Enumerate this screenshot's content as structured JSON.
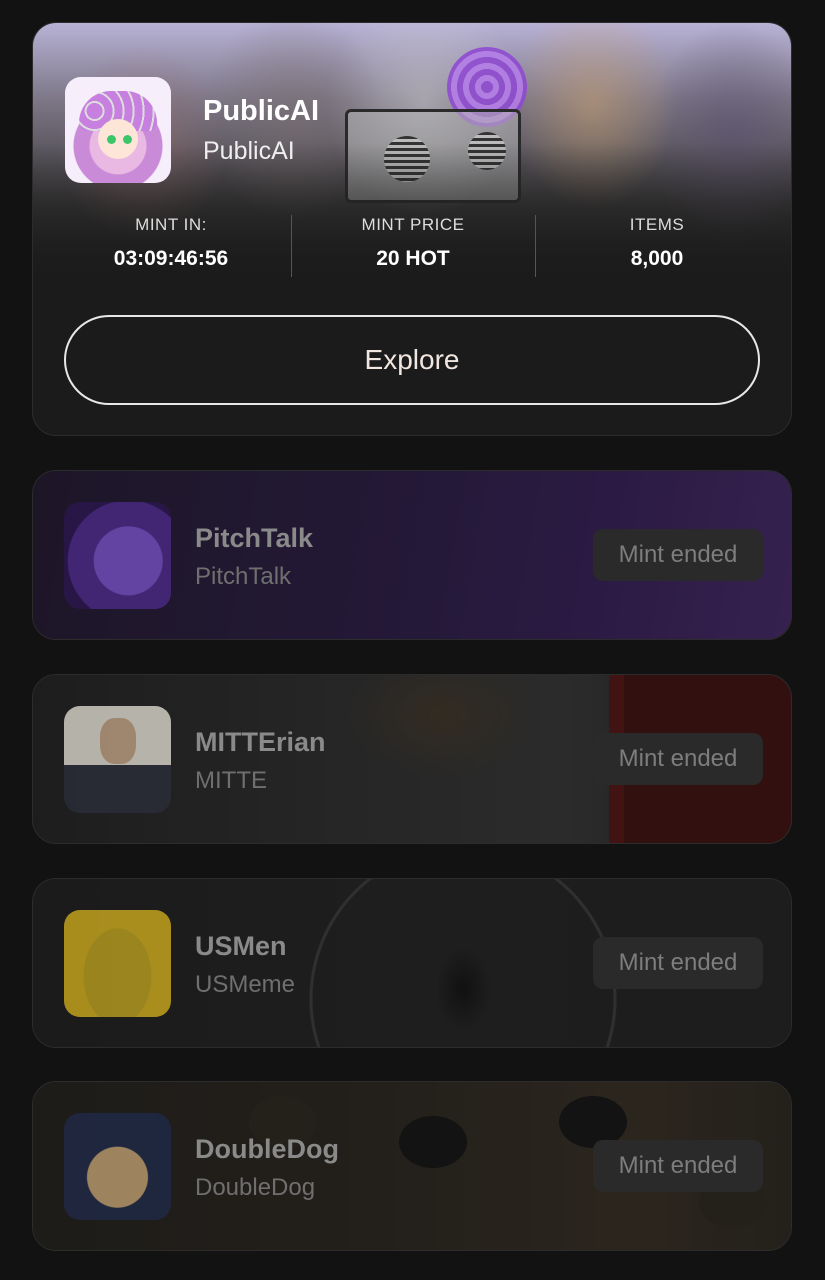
{
  "featured": {
    "title": "PublicAI",
    "subtitle": "PublicAI",
    "stats": [
      {
        "label": "MINT IN:",
        "value": "03:09:46:56"
      },
      {
        "label": "MINT PRICE",
        "value": "20 HOT"
      },
      {
        "label": "ITEMS",
        "value": "8,000"
      }
    ],
    "explore_label": "Explore"
  },
  "collections": [
    {
      "name": "PitchTalk",
      "subtitle": "PitchTalk",
      "status": "Mint ended"
    },
    {
      "name": "MITTErian",
      "subtitle": "MITTE",
      "status": "Mint ended"
    },
    {
      "name": "USMen",
      "subtitle": "USMeme",
      "status": "Mint ended"
    },
    {
      "name": "DoubleDog",
      "subtitle": "DoubleDog",
      "status": "Mint ended"
    }
  ]
}
